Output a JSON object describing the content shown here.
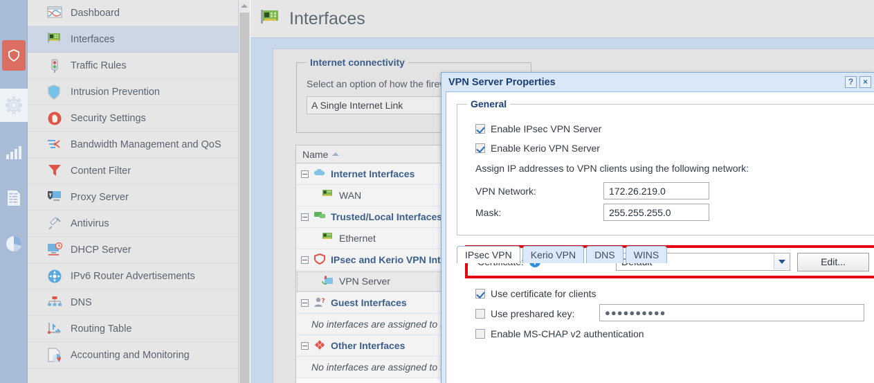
{
  "rail": {
    "items": [
      {
        "name": "shield-icon",
        "active": true
      },
      {
        "name": "gear-icon",
        "active": false
      },
      {
        "name": "bar-chart-icon",
        "active": false
      },
      {
        "name": "document-icon",
        "active": false
      },
      {
        "name": "pie-chart-icon",
        "active": false
      }
    ]
  },
  "sidebar": {
    "items": [
      {
        "label": "Dashboard",
        "icon": "dashboard-icon",
        "selected": false
      },
      {
        "label": "Interfaces",
        "icon": "network-card-icon",
        "selected": true
      },
      {
        "label": "Traffic Rules",
        "icon": "traffic-light-icon",
        "selected": false
      },
      {
        "label": "Intrusion Prevention",
        "icon": "shield-icon",
        "selected": false
      },
      {
        "label": "Security Settings",
        "icon": "hand-stop-icon",
        "selected": false
      },
      {
        "label": "Bandwidth Management and QoS",
        "icon": "bandwidth-icon",
        "selected": false
      },
      {
        "label": "Content Filter",
        "icon": "funnel-icon",
        "selected": false
      },
      {
        "label": "Proxy Server",
        "icon": "proxy-icon",
        "selected": false
      },
      {
        "label": "Antivirus",
        "icon": "syringe-icon",
        "selected": false
      },
      {
        "label": "DHCP Server",
        "icon": "monitor-clock-icon",
        "selected": false
      },
      {
        "label": "IPv6 Router Advertisements",
        "icon": "ipv6-icon",
        "selected": false
      },
      {
        "label": "DNS",
        "icon": "dns-tree-icon",
        "selected": false
      },
      {
        "label": "Routing Table",
        "icon": "routing-icon",
        "selected": false
      },
      {
        "label": "Accounting and Monitoring",
        "icon": "accounting-icon",
        "selected": false
      }
    ]
  },
  "header": {
    "title": "Interfaces",
    "icon": "network-card-icon"
  },
  "internet_connectivity": {
    "legend": "Internet connectivity",
    "description": "Select an option of how the firewall is",
    "selected_option": "A Single Internet Link"
  },
  "interfaces_table": {
    "column_header": "Name",
    "sort_direction": "ascending",
    "rows": [
      {
        "type": "group",
        "label": "Internet Interfaces",
        "icon": "cloud-icon",
        "expanded": true
      },
      {
        "type": "child",
        "label": "WAN",
        "icon": "network-card-icon",
        "selected": false
      },
      {
        "type": "group",
        "label": "Trusted/Local Interfaces",
        "icon": "lan-icon",
        "expanded": true
      },
      {
        "type": "child",
        "label": "Ethernet",
        "icon": "network-card-icon",
        "selected": false
      },
      {
        "type": "group",
        "label": "IPsec and Kerio VPN Interfa",
        "icon": "shield-icon",
        "expanded": true
      },
      {
        "type": "child",
        "label": "VPN Server",
        "icon": "vpn-icon",
        "selected": true
      },
      {
        "type": "group",
        "label": "Guest Interfaces",
        "icon": "guest-user-icon",
        "expanded": true
      },
      {
        "type": "empty",
        "label": "No interfaces are assigned to this g"
      },
      {
        "type": "group",
        "label": "Other Interfaces",
        "icon": "diamond-icon",
        "expanded": true
      },
      {
        "type": "empty",
        "label": "No interfaces are assigned to this g"
      }
    ]
  },
  "dialog": {
    "title": "VPN Server Properties",
    "help_button": "?",
    "close_button": "×",
    "general": {
      "legend": "General",
      "enable_ipsec": {
        "label": "Enable IPsec VPN Server",
        "checked": true
      },
      "enable_kerio": {
        "label": "Enable Kerio VPN Server",
        "checked": true
      },
      "assign_text": "Assign IP addresses to VPN clients using the following network:",
      "vpn_network_label": "VPN Network:",
      "vpn_network_value": "172.26.219.0",
      "mask_label": "Mask:",
      "mask_value": "255.255.255.0"
    },
    "tabs": [
      {
        "label": "IPsec VPN",
        "active": true
      },
      {
        "label": "Kerio VPN",
        "active": false
      },
      {
        "label": "DNS",
        "active": false
      },
      {
        "label": "WINS",
        "active": false
      }
    ],
    "certificate": {
      "label": "Certificate:",
      "info_icon": "info-icon",
      "selected": "Default",
      "edit_button": "Edit...",
      "highlight_color": "#e30613"
    },
    "options": {
      "use_certificate": {
        "label": "Use certificate for clients",
        "checked": true
      },
      "use_preshared_key": {
        "label": "Use preshared key:",
        "checked": false,
        "value": "●●●●●●●●●●"
      },
      "enable_mschap": {
        "label": "Enable MS-CHAP v2 authentication",
        "checked": false
      }
    }
  },
  "colors": {
    "accent_red": "#e30613",
    "rail_bg": "#a8bcd8",
    "rail_active": "#dc6d61",
    "sidebar_bg": "#e6e6e6",
    "sidebar_selected": "#ccd6e4",
    "main_bg": "#c8d8ec",
    "dialog_header": "#d9e7f7",
    "link_blue": "#3b5e8c"
  }
}
